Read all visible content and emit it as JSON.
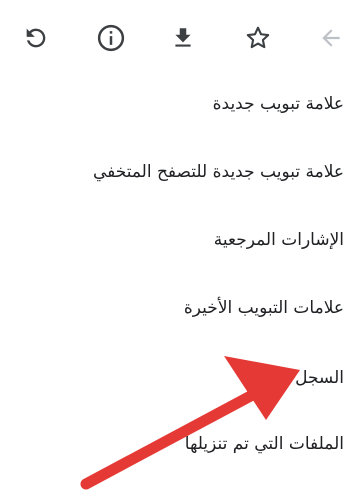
{
  "toolbar": {
    "buttons": [
      {
        "name": "refresh-icon"
      },
      {
        "name": "info-icon"
      },
      {
        "name": "download-icon"
      },
      {
        "name": "star-icon"
      },
      {
        "name": "forward-arrow-icon"
      }
    ]
  },
  "menu": {
    "items": [
      {
        "label": "علامة تبويب جديدة"
      },
      {
        "label": "علامة تبويب جديدة للتصفح المتخفي"
      },
      {
        "label": "الإشارات المرجعية"
      },
      {
        "label": "علامات التبويب الأخيرة"
      },
      {
        "label": "السجل"
      },
      {
        "label": "الملفات التي تم تنزيلها"
      }
    ]
  },
  "annotation": {
    "color": "#e53935"
  }
}
